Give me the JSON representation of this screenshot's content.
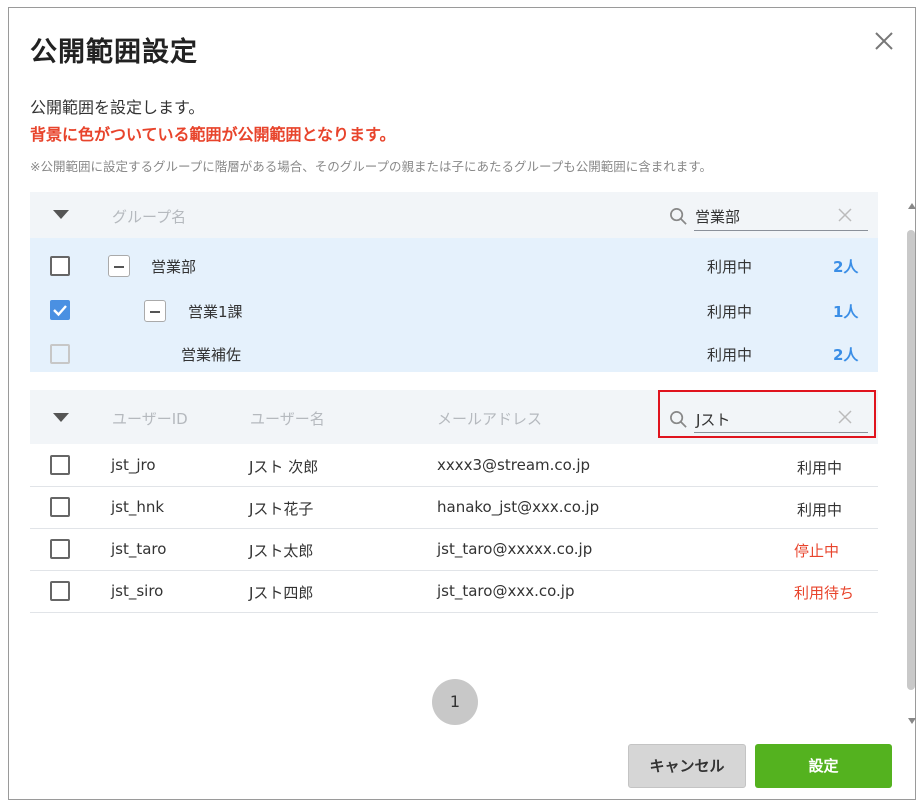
{
  "dialog": {
    "title": "公開範囲設定",
    "description": "公開範囲を設定します。",
    "warning": "背景に色がついている範囲が公開範囲となります。",
    "note": "※公開範囲に設定するグループに階層がある場合、そのグループの親または子にあたるグループも公開範囲に含まれます。"
  },
  "group_table": {
    "header_label": "グループ名",
    "search_value": "営業部",
    "rows": [
      {
        "name": "営業部",
        "status": "利用中",
        "count": "2人",
        "checked": false
      },
      {
        "name": "営業1課",
        "status": "利用中",
        "count": "1人",
        "checked": true
      },
      {
        "name": "営業補佐",
        "status": "利用中",
        "count": "2人",
        "checked": false
      }
    ]
  },
  "user_table": {
    "columns": [
      "ユーザーID",
      "ユーザー名",
      "メールアドレス"
    ],
    "search_value": "Jスト",
    "rows": [
      {
        "id": "jst_jro",
        "name": "Jスト 次郎",
        "email": "xxxx3@stream.co.jp",
        "status": "利用中"
      },
      {
        "id": "jst_hnk",
        "name": "Jスト花子",
        "email": "hanako_jst@xxx.co.jp",
        "status": "利用中"
      },
      {
        "id": "jst_taro",
        "name": "Jスト太郎",
        "email": "jst_taro@xxxxx.co.jp",
        "status": "停止中"
      },
      {
        "id": "jst_siro",
        "name": "Jスト四郎",
        "email": "jst_taro@xxx.co.jp",
        "status": "利用待ち"
      }
    ]
  },
  "pagination": {
    "current_page": "1"
  },
  "buttons": {
    "cancel": "キャンセル",
    "ok": "設定"
  },
  "colors": {
    "warning": "#e8442c",
    "primary": "#54b21f",
    "selection_bg": "#e5f1fc",
    "link": "#3a8ee6",
    "highlight_border": "#e0141e"
  },
  "icons": [
    "close-icon",
    "search-icon",
    "clear-icon",
    "collapse-triangle-icon",
    "minus-toggle-icon",
    "check-icon"
  ]
}
